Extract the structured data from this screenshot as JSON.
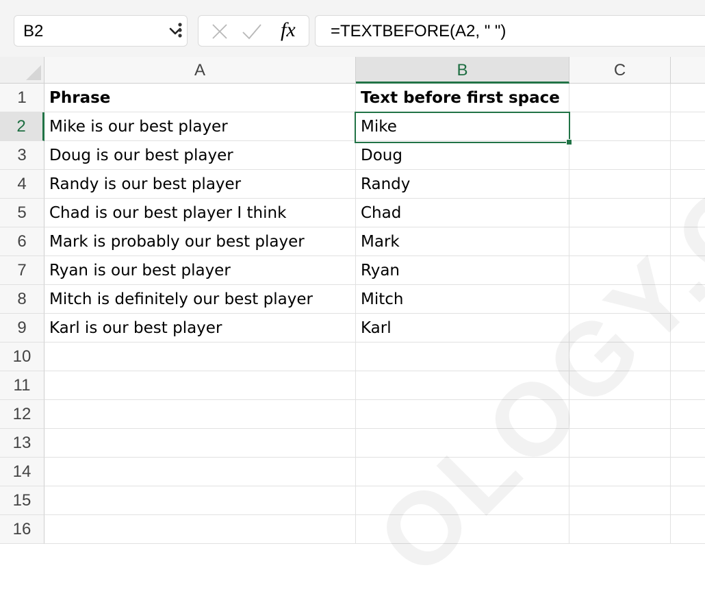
{
  "formula_bar": {
    "name_box": "B2",
    "fx_label": "fx",
    "formula": "=TEXTBEFORE(A2, \" \")"
  },
  "columns": [
    "A",
    "B",
    "C"
  ],
  "selected_cell": {
    "col": "B",
    "row": "2"
  },
  "rows": [
    {
      "num": "1",
      "a": "Phrase",
      "b": "Text before first space",
      "header": true
    },
    {
      "num": "2",
      "a": "Mike is our best player",
      "b": "Mike"
    },
    {
      "num": "3",
      "a": "Doug is our best player",
      "b": "Doug"
    },
    {
      "num": "4",
      "a": "Randy is our best player",
      "b": "Randy"
    },
    {
      "num": "5",
      "a": "Chad is our best player I think",
      "b": "Chad"
    },
    {
      "num": "6",
      "a": "Mark is probably our best player",
      "b": "Mark"
    },
    {
      "num": "7",
      "a": "Ryan is our best player",
      "b": "Ryan"
    },
    {
      "num": "8",
      "a": "Mitch is definitely our best player",
      "b": "Mitch"
    },
    {
      "num": "9",
      "a": "Karl is our best player",
      "b": "Karl"
    },
    {
      "num": "10",
      "a": "",
      "b": ""
    },
    {
      "num": "11",
      "a": "",
      "b": ""
    },
    {
      "num": "12",
      "a": "",
      "b": ""
    },
    {
      "num": "13",
      "a": "",
      "b": ""
    },
    {
      "num": "14",
      "a": "",
      "b": ""
    },
    {
      "num": "15",
      "a": "",
      "b": ""
    },
    {
      "num": "16",
      "a": "",
      "b": ""
    }
  ],
  "watermark": "OLOGY.C",
  "colors": {
    "accent": "#217346",
    "header_bg": "#f7f7f7",
    "selected_header_bg": "#e2e2e2"
  }
}
